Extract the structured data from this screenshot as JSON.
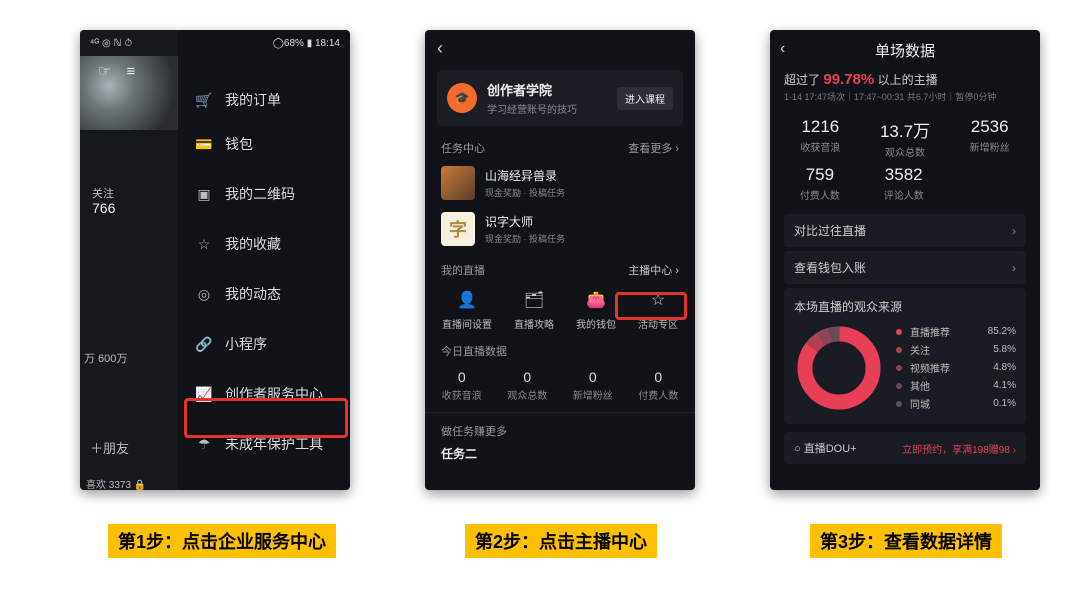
{
  "captions": {
    "step1": "第1步：点击企业服务中心",
    "step2": "第2步：点击主播中心",
    "step3": "第3步：查看数据详情"
  },
  "s1": {
    "statusLeft": "⁴ᴳ ◎ ℕ ⏱",
    "statusRight": "◯68% ▮ 18:14",
    "follow_label": "关注",
    "follow_count": "766",
    "fans": "万 600万",
    "friend": "＋朋友",
    "likes": "喜欢 3373 🔒",
    "menu": [
      {
        "icon": "🛒",
        "label": "我的订单"
      },
      {
        "icon": "💳",
        "label": "钱包"
      },
      {
        "icon": "▣",
        "label": "我的二维码"
      },
      {
        "icon": "☆",
        "label": "我的收藏"
      },
      {
        "icon": "◎",
        "label": "我的动态"
      },
      {
        "icon": "🔗",
        "label": "小程序"
      },
      {
        "icon": "📈",
        "label": "创作者服务中心"
      },
      {
        "icon": "☂",
        "label": "未成年保护工具"
      }
    ]
  },
  "s2": {
    "back": "‹",
    "academy": {
      "title": "创作者学院",
      "sub": "学习经营账号的技巧",
      "btn": "进入课程"
    },
    "taskHdr": {
      "l": "任务中心",
      "r": "查看更多 ›"
    },
    "tasks": [
      {
        "title": "山海经异兽录",
        "sub": "现金奖励 · 投稿任务"
      },
      {
        "title": "识字大师",
        "sub": "现金奖励 · 投稿任务"
      }
    ],
    "mylive": {
      "l": "我的直播",
      "r": "主播中心 ›"
    },
    "grid": [
      {
        "icon": "👤",
        "label": "直播间设置"
      },
      {
        "icon": "🗂",
        "label": "直播攻略"
      },
      {
        "icon": "👛",
        "label": "我的钱包"
      },
      {
        "icon": "☆",
        "label": "活动专区"
      }
    ],
    "todayHdr": "今日直播数据",
    "stats": [
      {
        "n": "0",
        "l": "收获音浪"
      },
      {
        "n": "0",
        "l": "观众总数"
      },
      {
        "n": "0",
        "l": "新增粉丝"
      },
      {
        "n": "0",
        "l": "付费人数"
      }
    ],
    "moreHdr": "做任务赚更多",
    "moreSub": "任务二"
  },
  "s3": {
    "title": "单场数据",
    "back": "‹",
    "exceed_pre": "超过了",
    "exceed_pct": "99.78%",
    "exceed_post": "以上的主播",
    "subline": "1-14 17:47场次｜17:47~00:31 共6.7小时｜暂停0分钟",
    "big": [
      {
        "n": "1216",
        "l": "收获音浪"
      },
      {
        "n": "13.7万",
        "l": "观众总数"
      },
      {
        "n": "2536",
        "l": "新增粉丝"
      }
    ],
    "big2": [
      {
        "n": "759",
        "l": "付费人数"
      },
      {
        "n": "3582",
        "l": "评论人数"
      }
    ],
    "nav": [
      {
        "label": "对比过往直播"
      },
      {
        "label": "查看钱包入账"
      }
    ],
    "sourceHdr": "本场直播的观众来源",
    "chart_series": [
      {
        "name": "直播推荐",
        "value": 85.2,
        "color": "#e83e56"
      },
      {
        "name": "关注",
        "value": 5.8,
        "color": "#b24055"
      },
      {
        "name": "视频推荐",
        "value": 4.8,
        "color": "#8c4457"
      },
      {
        "name": "其他",
        "value": 4.1,
        "color": "#6b4a57"
      },
      {
        "name": "同城",
        "value": 0.1,
        "color": "#5a5257"
      }
    ],
    "dou": {
      "l": "○ 直播DOU+",
      "r": "立即预约，享满198赠98 ›"
    }
  },
  "chart_data": {
    "type": "pie",
    "title": "本场直播的观众来源",
    "series": [
      {
        "name": "直播推荐",
        "value": 85.2
      },
      {
        "name": "关注",
        "value": 5.8
      },
      {
        "name": "视频推荐",
        "value": 4.8
      },
      {
        "name": "其他",
        "value": 4.1
      },
      {
        "name": "同城",
        "value": 0.1
      }
    ]
  }
}
